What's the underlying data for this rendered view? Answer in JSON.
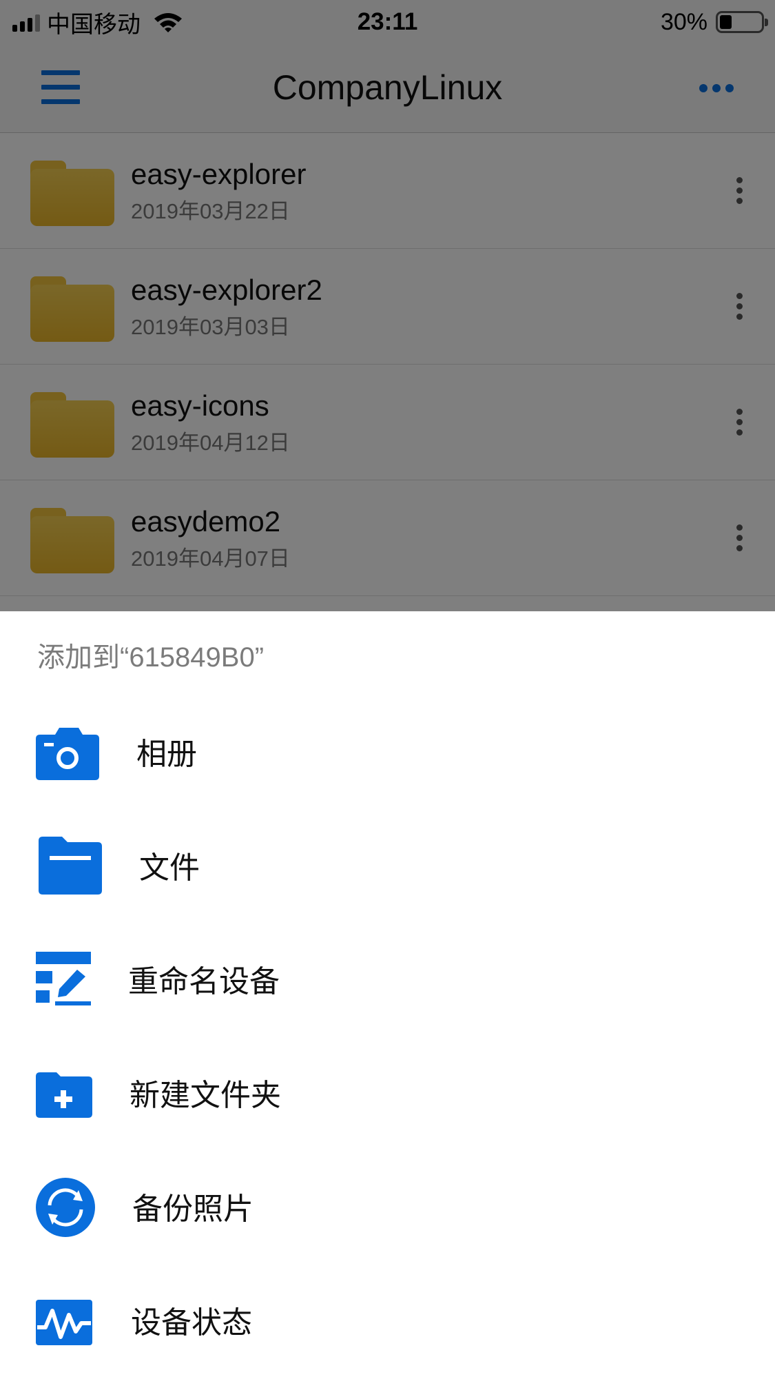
{
  "status_bar": {
    "carrier": "中国移动",
    "time": "23:11",
    "battery": "30%",
    "battery_level": 0.3
  },
  "nav": {
    "title": "CompanyLinux",
    "menu_icon": "hamburger-menu-icon",
    "more_icon": "more-horizontal-icon"
  },
  "files": [
    {
      "name": "easy-explorer",
      "date": "2019年03月22日"
    },
    {
      "name": "easy-explorer2",
      "date": "2019年03月03日"
    },
    {
      "name": "easy-icons",
      "date": "2019年04月12日"
    },
    {
      "name": "easydemo2",
      "date": "2019年04月07日"
    }
  ],
  "sheet": {
    "title": "添加到“615849B0”",
    "actions": [
      {
        "label": "相册",
        "icon": "camera-icon"
      },
      {
        "label": "文件",
        "icon": "folder-icon"
      },
      {
        "label": "重命名设备",
        "icon": "rename-icon"
      },
      {
        "label": "新建文件夹",
        "icon": "new-folder-icon"
      },
      {
        "label": "备份照片",
        "icon": "sync-icon"
      },
      {
        "label": "设备状态",
        "icon": "activity-icon"
      }
    ]
  },
  "colors": {
    "accent": "#0a6edc",
    "folder": "#f0c33c",
    "overlay": "rgba(0,0,0,0.5)"
  }
}
